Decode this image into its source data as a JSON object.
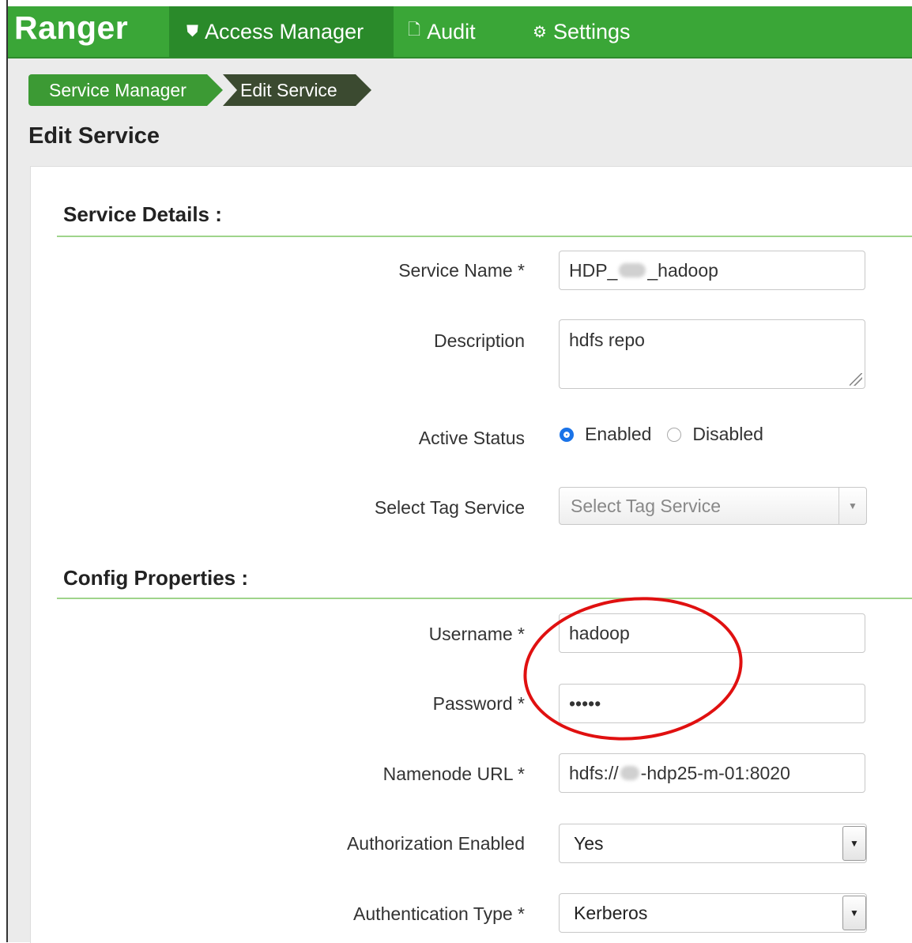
{
  "nav": {
    "brand": "Ranger",
    "items": [
      {
        "label": "Access Manager",
        "icon": "shield-icon",
        "active": true
      },
      {
        "label": "Audit",
        "icon": "file-icon",
        "active": false
      },
      {
        "label": "Settings",
        "icon": "gear-icon",
        "active": false
      }
    ]
  },
  "breadcrumb": [
    "Service Manager",
    "Edit Service"
  ],
  "page_title": "Edit Service",
  "service_details": {
    "title": "Service Details :",
    "service_name": {
      "label": "Service Name *",
      "value_prefix": "HDP_",
      "value_suffix": "_hadoop"
    },
    "description": {
      "label": "Description",
      "value": "hdfs repo"
    },
    "active_status": {
      "label": "Active Status",
      "enabled": "Enabled",
      "disabled": "Disabled",
      "selected": "Enabled"
    },
    "tag_service": {
      "label": "Select Tag Service",
      "placeholder": "Select Tag Service"
    }
  },
  "config": {
    "title": "Config Properties :",
    "username": {
      "label": "Username *",
      "value": "hadoop"
    },
    "password": {
      "label": "Password *",
      "value": "•••••"
    },
    "namenode": {
      "label": "Namenode URL *",
      "value_prefix": "hdfs://",
      "value_suffix": "-hdp25-m-01:8020"
    },
    "authorization": {
      "label": "Authorization Enabled",
      "value": "Yes"
    },
    "authentication": {
      "label": "Authentication Type *",
      "value": "Kerberos"
    }
  },
  "colors": {
    "nav_green": "#3aa637",
    "nav_active": "#2a8a2a",
    "breadcrumb_dark": "#3b4a30",
    "annotation_red": "#e01010",
    "radio_blue": "#1a73e8"
  }
}
